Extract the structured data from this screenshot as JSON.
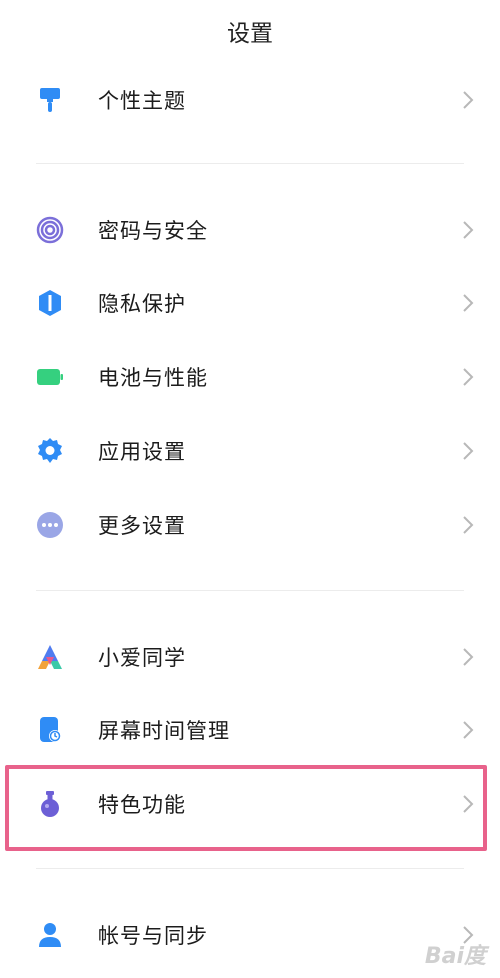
{
  "header": {
    "title": "设置"
  },
  "items": [
    {
      "label": "个性主题",
      "icon": "theme-brush-icon"
    },
    {
      "label": "密码与安全",
      "icon": "fingerprint-icon"
    },
    {
      "label": "隐私保护",
      "icon": "privacy-shield-icon"
    },
    {
      "label": "电池与性能",
      "icon": "battery-icon"
    },
    {
      "label": "应用设置",
      "icon": "gear-icon"
    },
    {
      "label": "更多设置",
      "icon": "more-dots-icon"
    },
    {
      "label": "小爱同学",
      "icon": "xiaoai-assistant-icon"
    },
    {
      "label": "屏幕时间管理",
      "icon": "screen-time-icon"
    },
    {
      "label": "特色功能",
      "icon": "flask-icon"
    },
    {
      "label": "帐号与同步",
      "icon": "user-account-icon"
    }
  ],
  "highlight": {
    "target": "特色功能",
    "color": "#e8628b"
  },
  "watermark": {
    "text": "Bai度"
  },
  "colors": {
    "theme": "#2f8cf5",
    "security": "#7b6fd9",
    "privacy": "#2f8cf5",
    "battery": "#35d07f",
    "settings": "#2f8cf5",
    "more": "#9aa6e6",
    "screen_time": "#2f8cf5",
    "feature": "#6c5fd6",
    "account": "#2f8cf5"
  }
}
